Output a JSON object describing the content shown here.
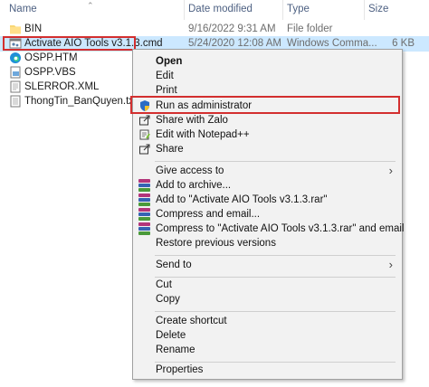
{
  "columns": {
    "name": "Name",
    "date": "Date modified",
    "type": "Type",
    "size": "Size"
  },
  "files": [
    {
      "name": "BIN",
      "date": "9/16/2022 9:31 AM",
      "type": "File folder",
      "size": "",
      "icon": "folder-icon"
    },
    {
      "name": "Activate AIO Tools v3.1.3.cmd",
      "date": "5/24/2020 12:08 AM",
      "type": "Windows Comma...",
      "size": "6 KB",
      "icon": "cmd-file-icon"
    },
    {
      "name": "OSPP.HTM",
      "date": "",
      "type": "",
      "size": "",
      "icon": "edge-html-icon"
    },
    {
      "name": "OSPP.VBS",
      "date": "",
      "type": "",
      "size": "",
      "icon": "vbs-file-icon"
    },
    {
      "name": "SLERROR.XML",
      "date": "",
      "type": "",
      "size": "",
      "icon": "xml-file-icon"
    },
    {
      "name": "ThongTin_BanQuyen.txt",
      "date": "",
      "type": "",
      "size": "",
      "icon": "text-file-icon"
    }
  ],
  "context_menu": {
    "open": "Open",
    "edit": "Edit",
    "print": "Print",
    "run_as_admin": "Run as administrator",
    "share_with_zalo": "Share with Zalo",
    "edit_with_notepad": "Edit with Notepad++",
    "share": "Share",
    "give_access_to": "Give access to",
    "add_to_archive": "Add to archive...",
    "add_to_rar": "Add to \"Activate AIO Tools v3.1.3.rar\"",
    "compress_email": "Compress and email...",
    "compress_rar_email": "Compress to \"Activate AIO Tools v3.1.3.rar\" and email",
    "restore_versions": "Restore previous versions",
    "send_to": "Send to",
    "cut": "Cut",
    "copy": "Copy",
    "create_shortcut": "Create shortcut",
    "delete": "Delete",
    "rename": "Rename",
    "properties": "Properties"
  },
  "colors": {
    "selection": "#cce8ff",
    "highlight_border": "#d32f2f",
    "menu_background": "#f2f2f2"
  }
}
